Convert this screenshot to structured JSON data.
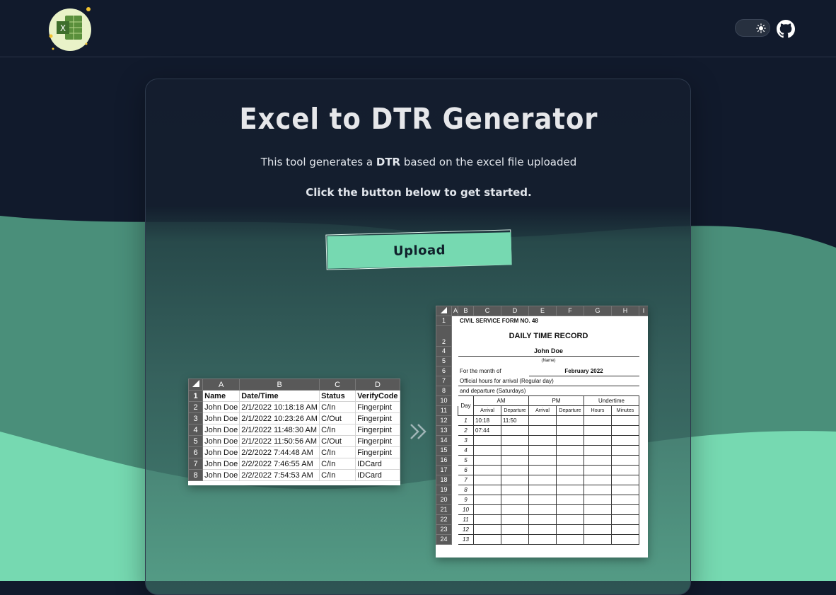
{
  "app": {
    "logo_icon": "excel-logo-icon",
    "theme_toggle_icon": "sun-icon",
    "github_icon": "github-icon"
  },
  "colors": {
    "background": "#111a2c",
    "accent": "#76d9b1",
    "wave_mid": "#4a8f7a",
    "wave_light": "#76d9b1"
  },
  "hero": {
    "title": "Excel to DTR Generator",
    "subtitle_before": "This tool generates a",
    "subtitle_bold": "DTR",
    "subtitle_after": "based on the excel file uploaded",
    "cta": "Click the button below to get started.",
    "upload_label": "Upload",
    "arrow_icon": "double-chevron-right-icon"
  },
  "excel_sample": {
    "columns": [
      "A",
      "B",
      "C",
      "D"
    ],
    "rows": [
      {
        "n": "1",
        "cells": [
          "Name",
          "Date/Time",
          "Status",
          "VerifyCode"
        ]
      },
      {
        "n": "2",
        "cells": [
          "John Doe",
          "2/1/2022 10:18:18 AM",
          "C/In",
          "Fingerpint"
        ]
      },
      {
        "n": "3",
        "cells": [
          "John Doe",
          "2/1/2022 10:23:26 AM",
          "C/Out",
          "Fingerpint"
        ]
      },
      {
        "n": "4",
        "cells": [
          "John Doe",
          "2/1/2022 11:48:30 AM",
          "C/In",
          "Fingerpint"
        ]
      },
      {
        "n": "5",
        "cells": [
          "John Doe",
          "2/1/2022 11:50:56 AM",
          "C/Out",
          "Fingerpint"
        ]
      },
      {
        "n": "6",
        "cells": [
          "John Doe",
          "2/2/2022 7:44:48 AM",
          "C/In",
          "Fingerpint"
        ]
      },
      {
        "n": "7",
        "cells": [
          "John Doe",
          "2/2/2022 7:46:55 AM",
          "C/In",
          "IDCard"
        ]
      },
      {
        "n": "8",
        "cells": [
          "John Doe",
          "2/2/2022 7:54:53 AM",
          "C/In",
          "IDCard"
        ]
      }
    ]
  },
  "dtr_sample": {
    "columns": [
      "A",
      "B",
      "C",
      "D",
      "E",
      "F",
      "G",
      "H",
      "I"
    ],
    "form_no": "CIVIL SERVICE FORM NO. 48",
    "heading": "DAILY TIME RECORD",
    "name": "John Doe",
    "name_caption": "(Name)",
    "month_label": "For the month of",
    "month_value": "February 2022",
    "hours_line1": "Official hours for arrival (Regular day)",
    "hours_line2": "and departure (Saturdays)",
    "col_day": "Day",
    "col_am": "AM",
    "col_pm": "PM",
    "col_undertime": "Undertime",
    "col_arrival": "Arrival",
    "col_departure": "Departure",
    "col_hours": "Hours",
    "col_minutes": "Minutes",
    "row_numbers": [
      "1",
      "2",
      "4",
      "5",
      "6",
      "7",
      "8",
      "10",
      "11"
    ],
    "days": [
      {
        "row": "12",
        "day": "1",
        "am_arrival": "10:18",
        "am_departure": "11:50"
      },
      {
        "row": "13",
        "day": "2",
        "am_arrival": "07:44",
        "am_departure": ""
      },
      {
        "row": "14",
        "day": "3",
        "am_arrival": "",
        "am_departure": ""
      },
      {
        "row": "15",
        "day": "4",
        "am_arrival": "",
        "am_departure": ""
      },
      {
        "row": "16",
        "day": "5",
        "am_arrival": "",
        "am_departure": ""
      },
      {
        "row": "17",
        "day": "6",
        "am_arrival": "",
        "am_departure": ""
      },
      {
        "row": "18",
        "day": "7",
        "am_arrival": "",
        "am_departure": ""
      },
      {
        "row": "19",
        "day": "8",
        "am_arrival": "",
        "am_departure": ""
      },
      {
        "row": "20",
        "day": "9",
        "am_arrival": "",
        "am_departure": ""
      },
      {
        "row": "21",
        "day": "10",
        "am_arrival": "",
        "am_departure": ""
      },
      {
        "row": "22",
        "day": "11",
        "am_arrival": "",
        "am_departure": ""
      },
      {
        "row": "23",
        "day": "12",
        "am_arrival": "",
        "am_departure": ""
      },
      {
        "row": "24",
        "day": "13",
        "am_arrival": "",
        "am_departure": ""
      }
    ]
  }
}
